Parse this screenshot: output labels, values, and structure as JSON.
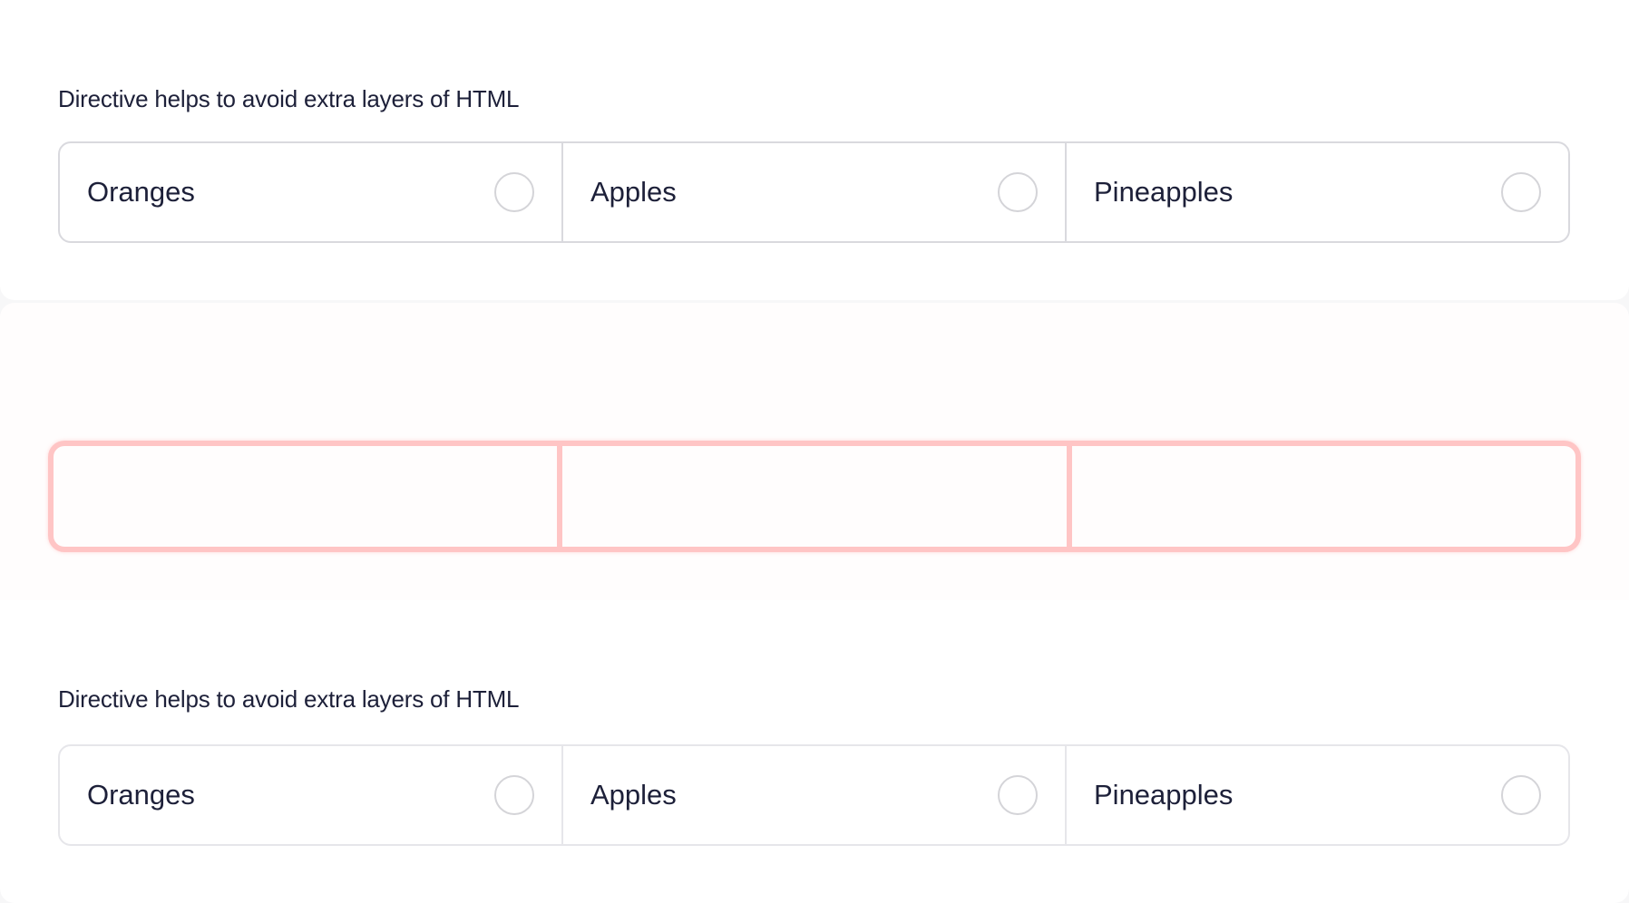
{
  "sections": [
    {
      "caption": "Directive helps to avoid extra layers of HTML",
      "options": [
        {
          "label": "Oranges",
          "selected": false
        },
        {
          "label": "Apples",
          "selected": false
        },
        {
          "label": "Pineapples",
          "selected": false
        }
      ]
    },
    {
      "caption": "Directive helps to avoid extra layers of HTML",
      "options": [
        {
          "label": "Oranges",
          "selected": false
        },
        {
          "label": "Apples",
          "selected": false
        },
        {
          "label": "Pineapples",
          "selected": false
        }
      ]
    }
  ],
  "highlight": {
    "cells": 3,
    "color": "#ffc5c5"
  },
  "colors": {
    "text": "#1d2039",
    "border": "#d9d9de",
    "radio_border": "#d4d4d8",
    "background": "#ffffff"
  }
}
